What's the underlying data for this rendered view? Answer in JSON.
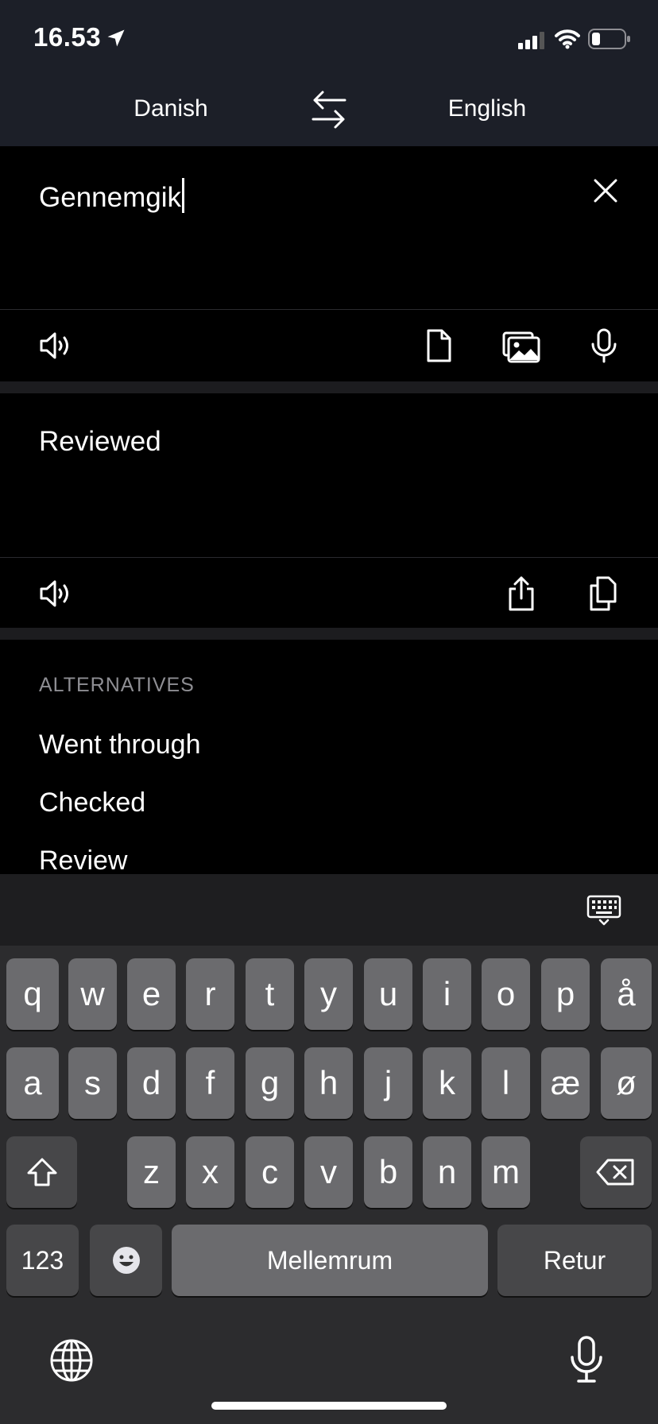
{
  "status_bar": {
    "time": "16.53"
  },
  "language_bar": {
    "source": "Danish",
    "target": "English"
  },
  "source": {
    "text": "Gennemgik"
  },
  "translation": {
    "text": "Reviewed"
  },
  "alternatives": {
    "header": "ALTERNATIVES",
    "items": [
      "Went through",
      "Checked",
      "Review"
    ]
  },
  "keyboard": {
    "row1": [
      "q",
      "w",
      "e",
      "r",
      "t",
      "y",
      "u",
      "i",
      "o",
      "p",
      "å"
    ],
    "row2": [
      "a",
      "s",
      "d",
      "f",
      "g",
      "h",
      "j",
      "k",
      "l",
      "æ",
      "ø"
    ],
    "row3": [
      "z",
      "x",
      "c",
      "v",
      "b",
      "n",
      "m"
    ],
    "numbers_label": "123",
    "space_label": "Mellemrum",
    "return_label": "Retur"
  }
}
